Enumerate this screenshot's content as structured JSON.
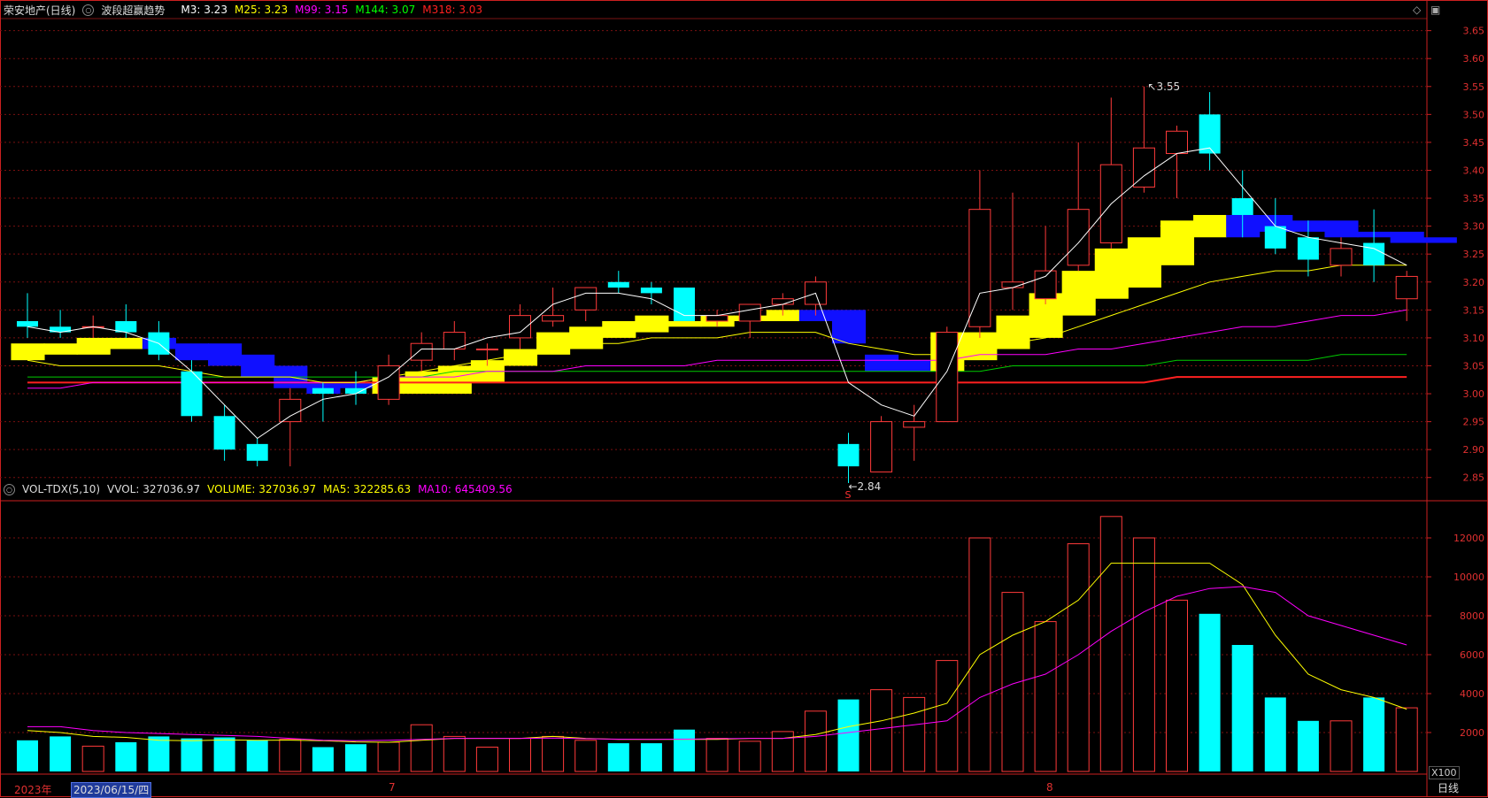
{
  "header_main": {
    "stock": "荣安地产(日线)",
    "indicator": "波段超赢趋势",
    "items": [
      {
        "label": "M3: 3.23",
        "color": "#ffffff"
      },
      {
        "label": "M25: 3.23",
        "color": "#ffff00"
      },
      {
        "label": "M99: 3.15",
        "color": "#ff00ff"
      },
      {
        "label": "M144: 3.07",
        "color": "#00ff00"
      },
      {
        "label": "M318: 3.03",
        "color": "#ff2020"
      }
    ]
  },
  "header_vol": {
    "indicator": "VOL-TDX(5,10)",
    "items": [
      {
        "label": "VVOL: 327036.97",
        "color": "#dddddd"
      },
      {
        "label": "VOLUME: 327036.97",
        "color": "#ffff00"
      },
      {
        "label": "MA5: 322285.63",
        "color": "#ffff00"
      },
      {
        "label": "MA10: 645409.56",
        "color": "#ff00ff"
      }
    ]
  },
  "footer": {
    "year": "2023年",
    "selected_date": "2023/06/15/四",
    "month_labels": [
      "7",
      "8"
    ],
    "period": "日线",
    "vol_unit": "X100"
  },
  "icons": [
    "circle-icon",
    "diamond-icon",
    "restore-icon"
  ],
  "colors": {
    "up": "#ff3a3a",
    "down": "#00ffff",
    "grid": "#7a1010",
    "axis": "#cc2020"
  },
  "chart_data": [
    {
      "type": "candlestick",
      "title": "荣安地产(日线)",
      "ylim": [
        2.81,
        3.67
      ],
      "yticks": [
        "2.85",
        "2.90",
        "2.95",
        "3.00",
        "3.05",
        "3.10",
        "3.15",
        "3.20",
        "3.25",
        "3.30",
        "3.35",
        "3.40",
        "3.45",
        "3.50",
        "3.55",
        "3.60",
        "3.65"
      ],
      "candles": [
        {
          "o": 3.13,
          "h": 3.18,
          "l": 3.1,
          "c": 3.12
        },
        {
          "o": 3.12,
          "h": 3.15,
          "l": 3.1,
          "c": 3.11
        },
        {
          "o": 3.12,
          "h": 3.14,
          "l": 3.1,
          "c": 3.12
        },
        {
          "o": 3.13,
          "h": 3.16,
          "l": 3.1,
          "c": 3.11
        },
        {
          "o": 3.11,
          "h": 3.13,
          "l": 3.06,
          "c": 3.07
        },
        {
          "o": 3.04,
          "h": 3.06,
          "l": 2.95,
          "c": 2.96
        },
        {
          "o": 2.96,
          "h": 2.98,
          "l": 2.88,
          "c": 2.9
        },
        {
          "o": 2.91,
          "h": 2.92,
          "l": 2.87,
          "c": 2.88
        },
        {
          "o": 2.95,
          "h": 3.01,
          "l": 2.87,
          "c": 2.99
        },
        {
          "o": 3.01,
          "h": 3.02,
          "l": 2.95,
          "c": 3.0
        },
        {
          "o": 3.01,
          "h": 3.04,
          "l": 2.98,
          "c": 3.0
        },
        {
          "o": 2.99,
          "h": 3.07,
          "l": 2.98,
          "c": 3.05
        },
        {
          "o": 3.06,
          "h": 3.11,
          "l": 3.04,
          "c": 3.09
        },
        {
          "o": 3.08,
          "h": 3.13,
          "l": 3.06,
          "c": 3.11
        },
        {
          "o": 3.08,
          "h": 3.09,
          "l": 3.05,
          "c": 3.08
        },
        {
          "o": 3.1,
          "h": 3.16,
          "l": 3.08,
          "c": 3.14
        },
        {
          "o": 3.13,
          "h": 3.19,
          "l": 3.12,
          "c": 3.14
        },
        {
          "o": 3.15,
          "h": 3.19,
          "l": 3.13,
          "c": 3.19
        },
        {
          "o": 3.2,
          "h": 3.22,
          "l": 3.18,
          "c": 3.19
        },
        {
          "o": 3.19,
          "h": 3.2,
          "l": 3.16,
          "c": 3.18
        },
        {
          "o": 3.19,
          "h": 3.19,
          "l": 3.13,
          "c": 3.13
        },
        {
          "o": 3.13,
          "h": 3.15,
          "l": 3.12,
          "c": 3.14
        },
        {
          "o": 3.13,
          "h": 3.16,
          "l": 3.1,
          "c": 3.16
        },
        {
          "o": 3.16,
          "h": 3.18,
          "l": 3.14,
          "c": 3.17
        },
        {
          "o": 3.16,
          "h": 3.21,
          "l": 3.14,
          "c": 3.2
        },
        {
          "o": 2.91,
          "h": 2.93,
          "l": 2.84,
          "c": 2.87
        },
        {
          "o": 2.86,
          "h": 2.96,
          "l": 2.86,
          "c": 2.95
        },
        {
          "o": 2.94,
          "h": 2.98,
          "l": 2.88,
          "c": 2.95
        },
        {
          "o": 2.95,
          "h": 3.12,
          "l": 2.95,
          "c": 3.11
        },
        {
          "o": 3.12,
          "h": 3.4,
          "l": 3.1,
          "c": 3.33
        },
        {
          "o": 3.19,
          "h": 3.36,
          "l": 3.15,
          "c": 3.2
        },
        {
          "o": 3.17,
          "h": 3.3,
          "l": 3.16,
          "c": 3.22
        },
        {
          "o": 3.23,
          "h": 3.45,
          "l": 3.22,
          "c": 3.33
        },
        {
          "o": 3.27,
          "h": 3.53,
          "l": 3.26,
          "c": 3.41
        },
        {
          "o": 3.37,
          "h": 3.55,
          "l": 3.36,
          "c": 3.44
        },
        {
          "o": 3.43,
          "h": 3.48,
          "l": 3.35,
          "c": 3.47
        },
        {
          "o": 3.5,
          "h": 3.54,
          "l": 3.4,
          "c": 3.43
        },
        {
          "o": 3.35,
          "h": 3.4,
          "l": 3.28,
          "c": 3.32
        },
        {
          "o": 3.3,
          "h": 3.35,
          "l": 3.25,
          "c": 3.26
        },
        {
          "o": 3.28,
          "h": 3.31,
          "l": 3.21,
          "c": 3.24
        },
        {
          "o": 3.23,
          "h": 3.28,
          "l": 3.21,
          "c": 3.26
        },
        {
          "o": 3.27,
          "h": 3.33,
          "l": 3.2,
          "c": 3.23
        },
        {
          "o": 3.17,
          "h": 3.22,
          "l": 3.13,
          "c": 3.21
        }
      ],
      "m3": [
        3.12,
        3.11,
        3.12,
        3.11,
        3.09,
        3.04,
        2.98,
        2.92,
        2.96,
        2.99,
        3.0,
        3.03,
        3.08,
        3.08,
        3.1,
        3.11,
        3.16,
        3.18,
        3.18,
        3.17,
        3.14,
        3.14,
        3.15,
        3.16,
        3.18,
        3.02,
        2.98,
        2.96,
        3.04,
        3.18,
        3.19,
        3.21,
        3.27,
        3.34,
        3.39,
        3.43,
        3.44,
        3.37,
        3.3,
        3.28,
        3.27,
        3.26,
        3.23
      ],
      "m25": [
        3.06,
        3.05,
        3.05,
        3.05,
        3.05,
        3.04,
        3.03,
        3.03,
        3.03,
        3.02,
        3.02,
        3.03,
        3.04,
        3.05,
        3.06,
        3.07,
        3.08,
        3.09,
        3.09,
        3.1,
        3.1,
        3.1,
        3.11,
        3.11,
        3.11,
        3.09,
        3.08,
        3.07,
        3.07,
        3.08,
        3.09,
        3.1,
        3.12,
        3.14,
        3.16,
        3.18,
        3.2,
        3.21,
        3.22,
        3.22,
        3.23,
        3.23,
        3.23
      ],
      "m99": [
        3.01,
        3.01,
        3.02,
        3.02,
        3.02,
        3.02,
        3.02,
        3.02,
        3.02,
        3.02,
        3.02,
        3.03,
        3.03,
        3.03,
        3.04,
        3.04,
        3.04,
        3.05,
        3.05,
        3.05,
        3.05,
        3.06,
        3.06,
        3.06,
        3.06,
        3.06,
        3.06,
        3.06,
        3.06,
        3.07,
        3.07,
        3.07,
        3.08,
        3.08,
        3.09,
        3.1,
        3.11,
        3.12,
        3.12,
        3.13,
        3.14,
        3.14,
        3.15
      ],
      "m144": [
        3.03,
        3.03,
        3.03,
        3.03,
        3.03,
        3.03,
        3.03,
        3.03,
        3.03,
        3.03,
        3.03,
        3.03,
        3.03,
        3.04,
        3.04,
        3.04,
        3.04,
        3.04,
        3.04,
        3.04,
        3.04,
        3.04,
        3.04,
        3.04,
        3.04,
        3.04,
        3.04,
        3.04,
        3.04,
        3.04,
        3.05,
        3.05,
        3.05,
        3.05,
        3.05,
        3.06,
        3.06,
        3.06,
        3.06,
        3.06,
        3.07,
        3.07,
        3.07
      ],
      "m318": [
        3.02,
        3.02,
        3.02,
        3.02,
        3.02,
        3.02,
        3.02,
        3.02,
        3.02,
        3.02,
        3.02,
        3.02,
        3.02,
        3.02,
        3.02,
        3.02,
        3.02,
        3.02,
        3.02,
        3.02,
        3.02,
        3.02,
        3.02,
        3.02,
        3.02,
        3.02,
        3.02,
        3.02,
        3.02,
        3.02,
        3.02,
        3.02,
        3.02,
        3.02,
        3.02,
        3.03,
        3.03,
        3.03,
        3.03,
        3.03,
        3.03,
        3.03,
        3.03
      ],
      "trend_band": [
        {
          "lo": 3.06,
          "hi": 3.09,
          "color": "yellow"
        },
        {
          "lo": 3.07,
          "hi": 3.09,
          "color": "yellow"
        },
        {
          "lo": 3.07,
          "hi": 3.1,
          "color": "yellow"
        },
        {
          "lo": 3.08,
          "hi": 3.1,
          "color": "yellow"
        },
        {
          "lo": 3.08,
          "hi": 3.1,
          "color": "blue"
        },
        {
          "lo": 3.06,
          "hi": 3.09,
          "color": "blue"
        },
        {
          "lo": 3.05,
          "hi": 3.09,
          "color": "blue"
        },
        {
          "lo": 3.03,
          "hi": 3.07,
          "color": "blue"
        },
        {
          "lo": 3.01,
          "hi": 3.05,
          "color": "blue"
        },
        {
          "lo": 3.0,
          "hi": 3.02,
          "color": "blue"
        },
        {
          "lo": 3.01,
          "hi": 3.02,
          "color": "blue"
        },
        {
          "lo": 3.0,
          "hi": 3.03,
          "color": "yellow"
        },
        {
          "lo": 3.0,
          "hi": 3.04,
          "color": "yellow"
        },
        {
          "lo": 3.0,
          "hi": 3.05,
          "color": "yellow"
        },
        {
          "lo": 3.02,
          "hi": 3.06,
          "color": "yellow"
        },
        {
          "lo": 3.05,
          "hi": 3.08,
          "color": "yellow"
        },
        {
          "lo": 3.07,
          "hi": 3.11,
          "color": "yellow"
        },
        {
          "lo": 3.08,
          "hi": 3.12,
          "color": "yellow"
        },
        {
          "lo": 3.1,
          "hi": 3.13,
          "color": "yellow"
        },
        {
          "lo": 3.11,
          "hi": 3.14,
          "color": "yellow"
        },
        {
          "lo": 3.12,
          "hi": 3.13,
          "color": "yellow"
        },
        {
          "lo": 3.12,
          "hi": 3.14,
          "color": "yellow"
        },
        {
          "lo": 3.13,
          "hi": 3.14,
          "color": "yellow"
        },
        {
          "lo": 3.13,
          "hi": 3.15,
          "color": "yellow"
        },
        {
          "lo": 3.13,
          "hi": 3.15,
          "color": "blue"
        },
        {
          "lo": 3.09,
          "hi": 3.15,
          "color": "blue"
        },
        {
          "lo": 3.04,
          "hi": 3.07,
          "color": "blue"
        },
        {
          "lo": 3.04,
          "hi": 3.06,
          "color": "blue"
        },
        {
          "lo": 3.04,
          "hi": 3.11,
          "color": "yellow"
        },
        {
          "lo": 3.06,
          "hi": 3.11,
          "color": "yellow"
        },
        {
          "lo": 3.08,
          "hi": 3.14,
          "color": "yellow"
        },
        {
          "lo": 3.1,
          "hi": 3.18,
          "color": "yellow"
        },
        {
          "lo": 3.14,
          "hi": 3.22,
          "color": "yellow"
        },
        {
          "lo": 3.17,
          "hi": 3.26,
          "color": "yellow"
        },
        {
          "lo": 3.19,
          "hi": 3.28,
          "color": "yellow"
        },
        {
          "lo": 3.23,
          "hi": 3.31,
          "color": "yellow"
        },
        {
          "lo": 3.28,
          "hi": 3.32,
          "color": "yellow"
        },
        {
          "lo": 3.28,
          "hi": 3.32,
          "color": "blue"
        },
        {
          "lo": 3.29,
          "hi": 3.32,
          "color": "blue"
        },
        {
          "lo": 3.29,
          "hi": 3.31,
          "color": "blue"
        },
        {
          "lo": 3.28,
          "hi": 3.31,
          "color": "blue"
        },
        {
          "lo": 3.28,
          "hi": 3.29,
          "color": "blue"
        },
        {
          "lo": 3.27,
          "hi": 3.29,
          "color": "blue"
        },
        {
          "lo": 3.27,
          "hi": 3.28,
          "color": "blue"
        }
      ],
      "annotations": [
        {
          "text": "3.55",
          "index": 34,
          "price": 3.55,
          "kind": "high"
        },
        {
          "text": "2.84",
          "index": 25,
          "price": 2.84,
          "kind": "low"
        },
        {
          "text": "S",
          "index": 25,
          "kind": "signal"
        }
      ]
    },
    {
      "type": "bar",
      "title": "VOL-TDX(5,10)",
      "ylim": [
        0,
        13500
      ],
      "yticks": [
        "2000",
        "4000",
        "6000",
        "8000",
        "10000",
        "12000"
      ],
      "volume": [
        1600,
        1800,
        1300,
        1500,
        1800,
        1700,
        1750,
        1600,
        1650,
        1250,
        1400,
        1500,
        2400,
        1800,
        1250,
        1700,
        1800,
        1600,
        1450,
        1450,
        2150,
        1700,
        1550,
        2050,
        3100,
        3700,
        4200,
        3800,
        5700,
        12000,
        9200,
        7700,
        11700,
        13100,
        12000,
        8800,
        8100,
        6500,
        3800,
        2600,
        2600,
        3800,
        3270
      ],
      "ma5": [
        2100,
        2000,
        1800,
        1750,
        1600,
        1580,
        1620,
        1600,
        1610,
        1580,
        1520,
        1500,
        1600,
        1700,
        1700,
        1700,
        1800,
        1700,
        1650,
        1650,
        1650,
        1650,
        1700,
        1700,
        1900,
        2300,
        2600,
        3000,
        3500,
        6000,
        7000,
        7700,
        8800,
        10700,
        10700,
        10700,
        10700,
        9600,
        7000,
        5000,
        4200,
        3800,
        3200
      ],
      "ma10": [
        2300,
        2300,
        2100,
        2000,
        1950,
        1900,
        1850,
        1800,
        1700,
        1600,
        1580,
        1600,
        1650,
        1700,
        1700,
        1700,
        1720,
        1680,
        1660,
        1650,
        1660,
        1680,
        1700,
        1700,
        1800,
        2000,
        2200,
        2400,
        2600,
        3800,
        4500,
        5000,
        6000,
        7200,
        8200,
        9000,
        9400,
        9500,
        9200,
        8000,
        7500,
        7000,
        6500
      ]
    }
  ]
}
